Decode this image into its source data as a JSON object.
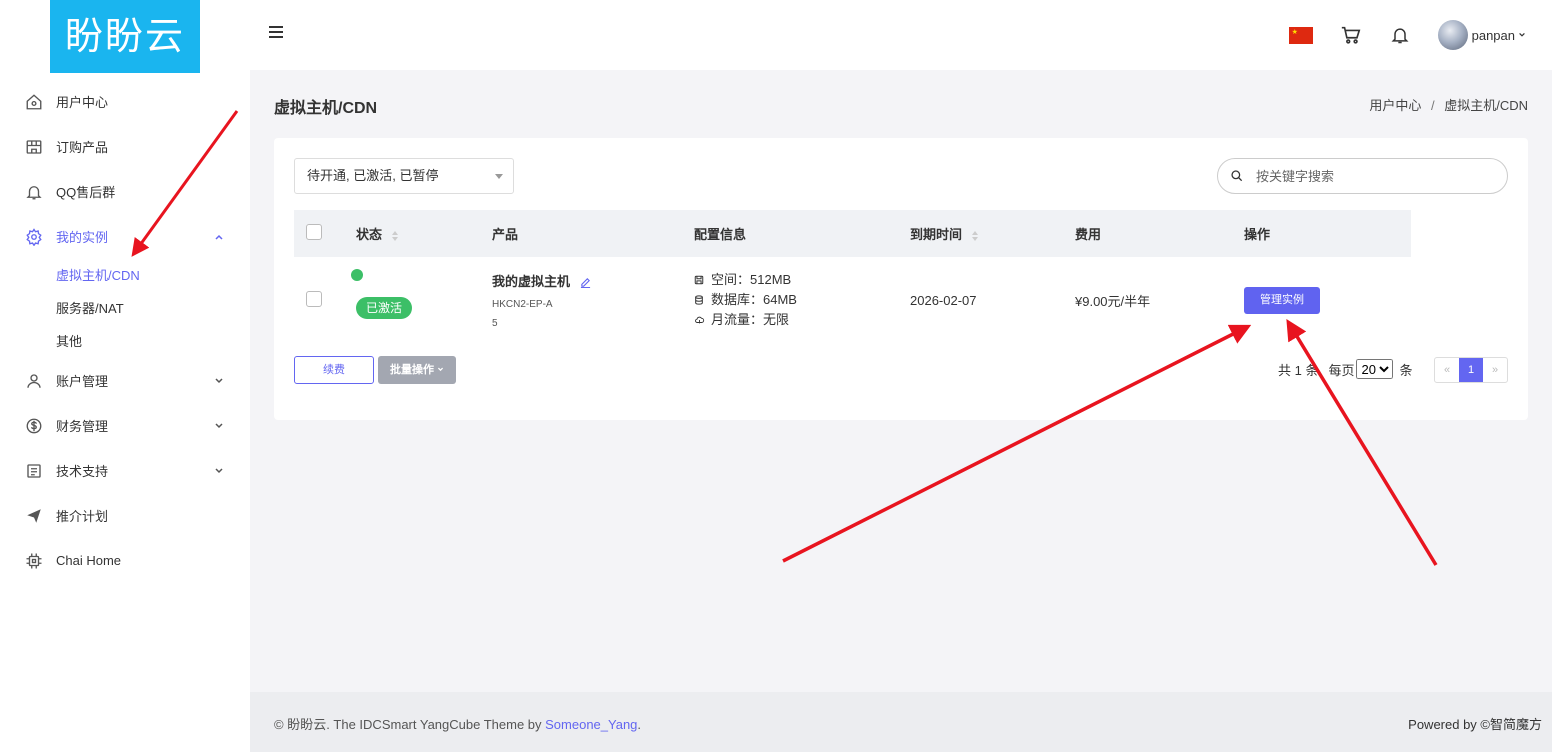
{
  "logo": {
    "text": "盼盼云"
  },
  "header": {
    "username": "panpan"
  },
  "sidebar": {
    "items": [
      {
        "label": "用户中心",
        "icon": "home-icon"
      },
      {
        "label": "订购产品",
        "icon": "store-icon"
      },
      {
        "label": "QQ售后群",
        "icon": "bell-icon"
      },
      {
        "label": "我的实例",
        "icon": "gear-icon"
      },
      {
        "label": "账户管理",
        "icon": "user-icon"
      },
      {
        "label": "财务管理",
        "icon": "dollar-icon"
      },
      {
        "label": "技术支持",
        "icon": "document-icon"
      },
      {
        "label": "推介计划",
        "icon": "send-icon"
      },
      {
        "label": "Chai Home",
        "icon": "chip-icon"
      }
    ],
    "subitems": [
      {
        "label": "虚拟主机/CDN",
        "active": true
      },
      {
        "label": "服务器/NAT"
      },
      {
        "label": "其他"
      }
    ]
  },
  "page": {
    "title": "虚拟主机/CDN",
    "breadcrumb": [
      "用户中心",
      "/",
      "虚拟主机/CDN"
    ]
  },
  "filter": {
    "status_value": "待开通, 已激活, 已暂停",
    "search_placeholder": "按关键字搜索"
  },
  "table": {
    "headers": [
      "状态",
      "产品",
      "配置信息",
      "到期时间",
      "费用",
      "操作"
    ],
    "rows": [
      {
        "status": "已激活",
        "product_name": "我的虚拟主机",
        "product_code": "HKCN2-EP-A",
        "product_id": "5",
        "config": [
          "空间：512MB",
          "数据库：64MB",
          "月流量：无限"
        ],
        "expire": "2026-02-07",
        "price": "¥9.00元/半年",
        "action": "管理实例"
      }
    ]
  },
  "actions": {
    "renew": "续费",
    "batch": "批量操作"
  },
  "pagination": {
    "total_prefix": "共 1 条",
    "per_page_label": "每页",
    "per_page_value": "20",
    "per_page_suffix": "条",
    "prev": "«",
    "current": "1",
    "next": "»"
  },
  "footer": {
    "left_prefix": "© 盼盼云. The IDCSmart YangCube Theme by ",
    "left_link": "Someone_Yang",
    "left_suffix": ".",
    "right": "Powered by ©智简魔方"
  },
  "colors": {
    "accent": "#6366f1",
    "logo_bg": "#1ab5ef",
    "active_green": "#3cbf67",
    "arrow_red": "#e8141f"
  }
}
